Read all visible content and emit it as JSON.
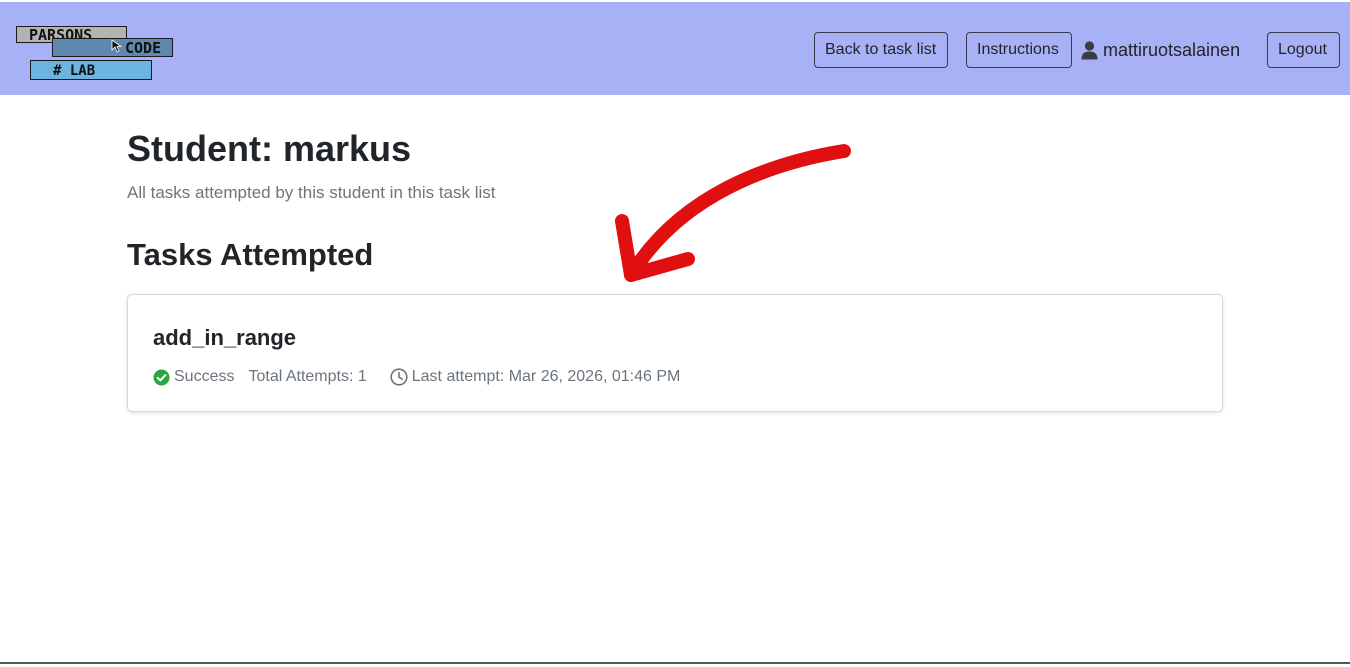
{
  "header": {
    "logo": {
      "line1": "PARSONS",
      "line2": "CODE",
      "line3": "# LAB"
    },
    "back_label": "Back to task list",
    "instructions_label": "Instructions",
    "username": "mattiruotsalainen",
    "logout_label": "Logout",
    "background_color": "#a8b1f5"
  },
  "main": {
    "title": "Student: markus",
    "subtitle": "All tasks attempted by this student in this task list",
    "section_title": "Tasks Attempted",
    "tasks": [
      {
        "name": "add_in_range",
        "status": "Success",
        "status_color": "#28a745",
        "total_attempts": "Total Attempts: 1",
        "last_attempt": "Last attempt: Mar 26, 2026, 01:46 PM"
      }
    ]
  },
  "annotation": {
    "type": "arrow",
    "color": "#e01010"
  },
  "icons": {
    "user": "user-icon",
    "success": "check-circle-icon",
    "clock": "clock-icon",
    "cursor": "cursor-icon"
  }
}
